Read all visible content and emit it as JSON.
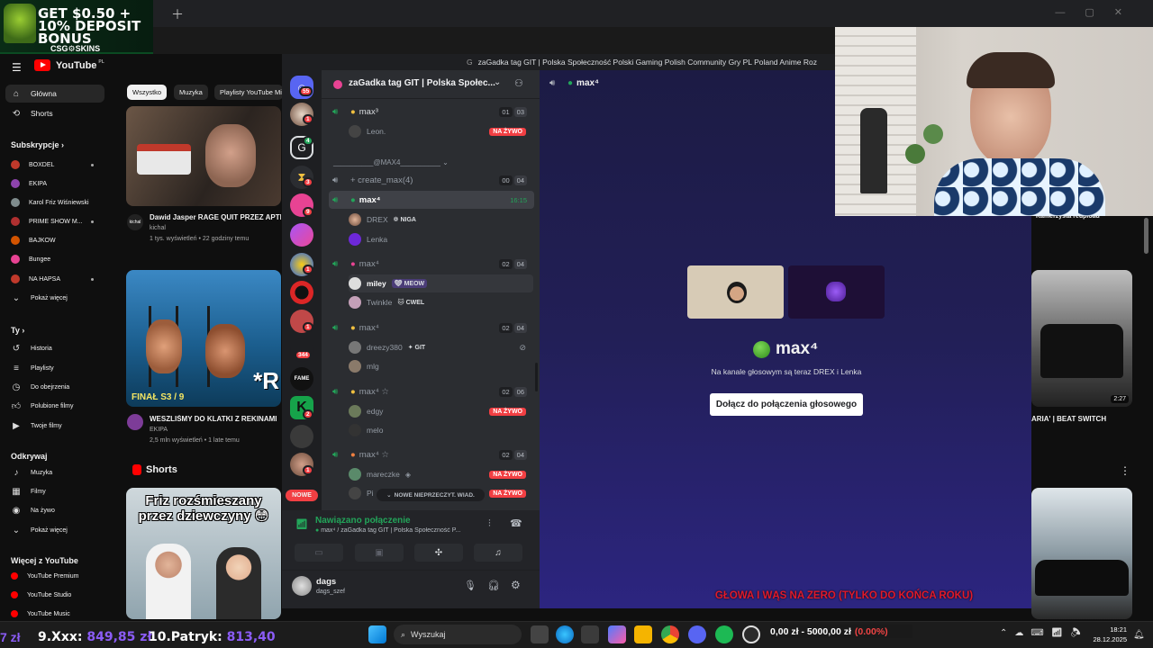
{
  "ad": {
    "text": "GET $0.50 + 10% DEPOSIT BONUS",
    "brand": "CSG⚙SKINS"
  },
  "youtube": {
    "logo": "YouTube",
    "logo_region": "PL",
    "nav": [
      {
        "label": "Główna",
        "icon": "home-icon"
      },
      {
        "label": "Shorts",
        "icon": "shorts-icon"
      }
    ],
    "subscriptions_header": "Subskrypcje",
    "subscriptions": [
      "BOXDEL",
      "EKIPA",
      "Karol Friz Wiśniewski",
      "PRIME SHOW M...",
      "BAJKOW",
      "Bungee",
      "NA HAPSA"
    ],
    "show_more": "Pokaż więcej",
    "you_header": "Ty",
    "you_items": [
      "Historia",
      "Playlisty",
      "Do obejrzenia",
      "Polubione filmy",
      "Twoje filmy"
    ],
    "explore_header": "Odkrywaj",
    "explore_items": [
      "Muzyka",
      "Filmy",
      "Na żywo"
    ],
    "show_more_2": "Pokaż więcej",
    "more_header": "Więcej z YouTube",
    "more_items": [
      "YouTube Premium",
      "YouTube Studio",
      "YouTube Music"
    ],
    "chips": [
      "Wszystko",
      "Muzyka",
      "Playlisty YouTube Mi"
    ],
    "videos": [
      {
        "title": "Dawid Jasper RAGE QUIT PRZEZ APTI",
        "channel": "kichal",
        "meta": "1 tys. wyświetleń • 22 godziny temu",
        "channel_badge": "kichal"
      },
      {
        "title": "WESZLIŚMY DO KLATKI Z REKINAMI",
        "channel": "EKIPA",
        "meta": "2,5 mln wyświetleń • 1 late temu",
        "overlay": "FINAŁ S3 / 9",
        "overlay2": "*R"
      }
    ],
    "shorts_header": "Shorts",
    "short_caption": "Friz rozśmieszany przez dziewczyny 😳",
    "right_video": {
      "title": "ARIA' | BEAT SWITCH",
      "duration": "2:27",
      "partial_title": "Kamerzysta reupload"
    },
    "more_menu": "⋮"
  },
  "discord": {
    "title_bar": "zaGadka tag GIT | Polska Społeczność Polski Gaming Polish Community Gry PL Poland Anime Roz",
    "server_name": "zaGadka tag GIT | Polska Społec...",
    "server_badges": [
      "55",
      "1",
      "4",
      "3",
      "9",
      "1",
      "1",
      "1",
      "344",
      "2",
      "1"
    ],
    "new_label": "NOWE",
    "channels": [
      {
        "name": "max³",
        "counts": [
          "01",
          "03"
        ],
        "users": [
          {
            "name": "Leon.",
            "live": true
          }
        ]
      },
      {
        "category": "__________@MAX4__________"
      },
      {
        "name": "+ create_max(4)",
        "counts": [
          "00",
          "04"
        ]
      },
      {
        "name": "max⁴",
        "time": "16:15",
        "users": [
          {
            "name": "DREX",
            "tag": "NIGA"
          },
          {
            "name": "Lenka"
          }
        ]
      },
      {
        "name": "max⁴",
        "counts": [
          "02",
          "04"
        ],
        "users": [
          {
            "name": "miley",
            "tag": "MEOW"
          },
          {
            "name": "Twinkle",
            "tag": "CWEL"
          }
        ]
      },
      {
        "name": "max⁴",
        "counts": [
          "02",
          "04"
        ],
        "users": [
          {
            "name": "dreezy380",
            "tag": "GIT"
          },
          {
            "name": "mlg"
          }
        ]
      },
      {
        "name": "max⁴ ☆",
        "counts": [
          "02",
          "06"
        ],
        "users": [
          {
            "name": "edgy",
            "live": true
          },
          {
            "name": "melo"
          }
        ]
      },
      {
        "name": "max⁴ ☆",
        "counts": [
          "02",
          "04"
        ],
        "users": [
          {
            "name": "mareczke",
            "live": true
          },
          {
            "name": "Pi",
            "live": true
          }
        ]
      }
    ],
    "live_label": "NA ŻYWO",
    "unread_pill": "NOWE NIEPRZECZYT. WIAD.",
    "voice_status": "Nawiązano połączenie",
    "voice_channel": "max⁴ / zaGadka tag GIT | Polska Społeczność P...",
    "user": {
      "name": "dags",
      "handle": "dags_szef"
    },
    "main_channel": "max⁴",
    "stage_title": "max⁴",
    "stage_subtitle": "Na kanale głosowym są teraz DREX i Lenka",
    "join_button": "Dołącz do połączenia głosowego"
  },
  "stream_overlays": {
    "red_text": "GŁOWA I WĄS NA ZERO (TYLKO DO KOŃCA ROKU)",
    "donor1_rank": "9.Xxx:",
    "donor1_amt": "849,85 zł",
    "donor2_rank": "10.Patryk:",
    "donor2_amt": "813,40",
    "left_amt": "7 zł",
    "goal_text": "0,00 zł - 5000,00 zł",
    "goal_pct": "(0.00%)"
  },
  "taskbar": {
    "search": "Wyszukaj",
    "time": "18:21",
    "date": "28.12.2025"
  },
  "colors": {
    "discord_green": "#23a55a",
    "live_red": "#f23f43",
    "yt_red": "#ff0000",
    "donor_purple": "#8b5cf6"
  }
}
